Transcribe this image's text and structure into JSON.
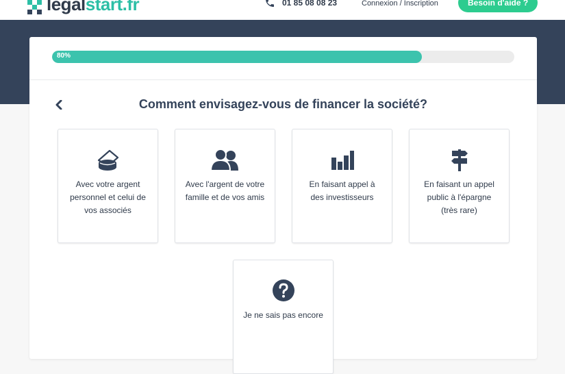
{
  "header": {
    "logo_main": "legal",
    "logo_accent": "start.fr",
    "phone": "01 85 08 08 23",
    "login_label": "Connexion / Inscription",
    "help_label": "Besoin d'aide ?"
  },
  "progress": {
    "percent_label": "80%",
    "value": 0.8
  },
  "question": "Comment envisagez-vous de financer la société?",
  "options": [
    {
      "label": "Avec votre argent personnel et celui de vos associés",
      "icon": "money-stack-icon"
    },
    {
      "label": "Avec l'argent de votre famille et de vos amis",
      "icon": "people-icon"
    },
    {
      "label": "En faisant appel à des investisseurs",
      "icon": "bar-chart-icon"
    },
    {
      "label": "En faisant un appel public à l'épargne (très rare)",
      "icon": "signpost-icon"
    },
    {
      "label": "Je ne sais pas encore",
      "icon": "question-icon"
    }
  ],
  "colors": {
    "accent": "#2dbfa6",
    "help_button": "#2dcc8f",
    "band": "#34435a",
    "progress_fill": "#3cc3ad"
  }
}
